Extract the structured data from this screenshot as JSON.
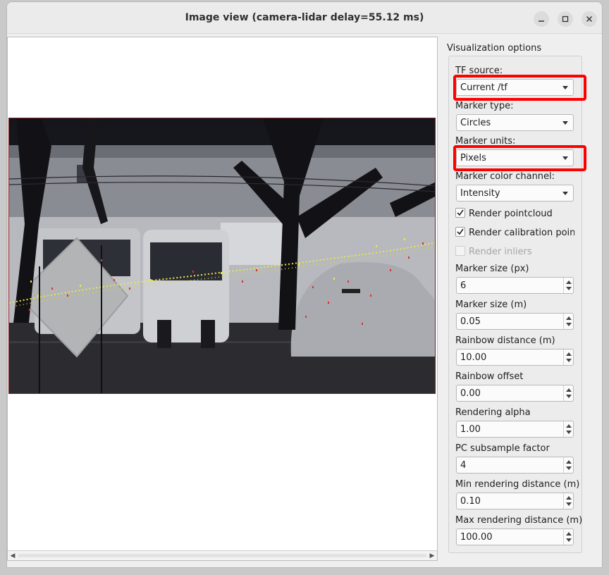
{
  "window": {
    "title": "Image view (camera-lidar delay=55.12 ms)"
  },
  "panel": {
    "title": "Visualization options",
    "tf_source": {
      "label": "TF source:",
      "value": "Current /tf"
    },
    "marker_type": {
      "label": "Marker type:",
      "value": "Circles"
    },
    "marker_units": {
      "label": "Marker units:",
      "value": "Pixels"
    },
    "marker_color_channel": {
      "label": "Marker color channel:",
      "value": "Intensity"
    },
    "checks": [
      {
        "label": "Render pointcloud",
        "checked": true,
        "enabled": true
      },
      {
        "label": "Render calibration points",
        "checked": true,
        "enabled": true
      },
      {
        "label": "Render inliers",
        "checked": false,
        "enabled": false
      }
    ],
    "spins": [
      {
        "label": "Marker size (px)",
        "value": "6"
      },
      {
        "label": "Marker size (m)",
        "value": "0.05"
      },
      {
        "label": "Rainbow distance (m)",
        "value": "10.00"
      },
      {
        "label": "Rainbow offset",
        "value": "0.00"
      },
      {
        "label": "Rendering alpha",
        "value": "1.00"
      },
      {
        "label": "PC subsample factor",
        "value": "4"
      },
      {
        "label": "Min rendering distance (m)",
        "value": "0.10"
      },
      {
        "label": "Max rendering distance (m)",
        "value": "100.00"
      }
    ]
  },
  "colors": {
    "highlight": "#ff0000",
    "point_yellow": "#e8e84a",
    "point_red": "#e03030"
  }
}
